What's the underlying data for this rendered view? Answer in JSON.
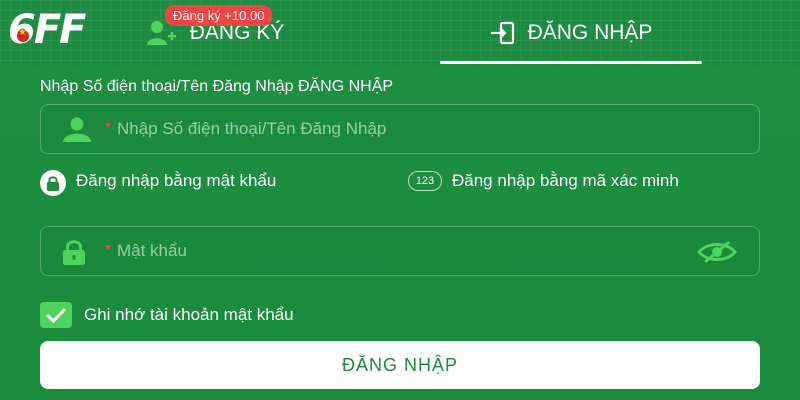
{
  "logo": {
    "text_six": "6",
    "text_ff": "FF"
  },
  "tabs": {
    "register": {
      "label": "ĐĂNG KÝ",
      "badge": "Đăng ký +10.00",
      "icon": "add-user-icon"
    },
    "login": {
      "label": "ĐĂNG NHẬP",
      "icon": "login-door-icon",
      "active": true
    }
  },
  "form": {
    "title": "Nhập Số điện thoại/Tên Đăng Nhập ĐĂNG NHẬP",
    "username": {
      "required_mark": "*",
      "placeholder": "Nhập Số điện thoại/Tên Đăng Nhập",
      "value": ""
    },
    "modes": {
      "password": {
        "label": "Đăng nhập bằng mật khẩu",
        "selected": true
      },
      "code": {
        "badge": "123",
        "label": "Đăng nhập bằng mã xác minh",
        "selected": false
      }
    },
    "password": {
      "required_mark": "*",
      "placeholder": "Mật khẩu",
      "value": ""
    },
    "remember": {
      "label": "Ghi nhớ tài khoản mật khẩu",
      "checked": true
    },
    "submit_label": "ĐĂNG NHẬP"
  },
  "colors": {
    "background": "#1c8a3f",
    "accent_green": "#4fd35c",
    "badge_red": "#f04545",
    "button_text": "#1c8a3f"
  }
}
